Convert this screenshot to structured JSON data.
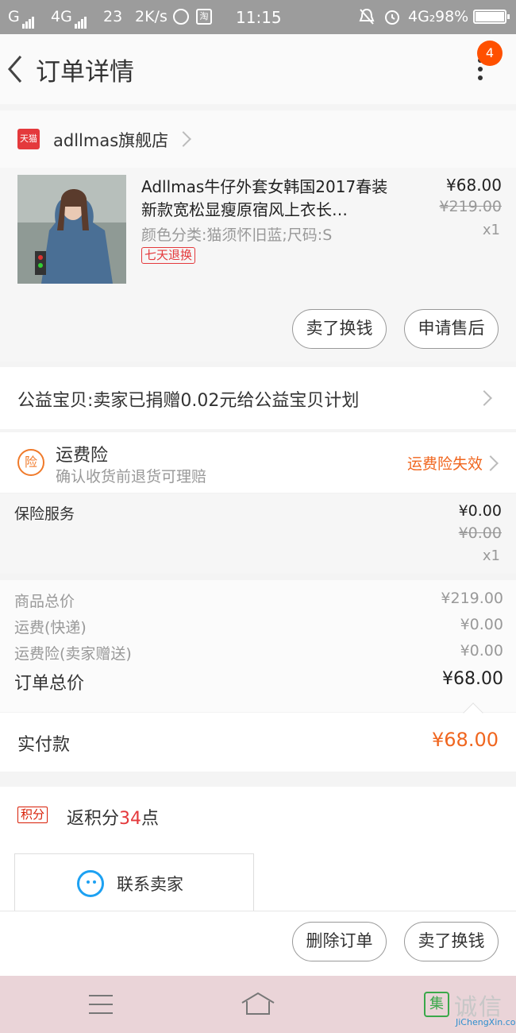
{
  "status_bar": {
    "carrier": "G",
    "network": "4G",
    "notif_count": "23",
    "speed": "2K/s",
    "time": "11:15",
    "network2": "4G₂",
    "battery": "98%"
  },
  "nav": {
    "title": "订单详情",
    "badge": "4"
  },
  "shop": {
    "tmall_tag": "天猫",
    "name": "adllmas旗舰店"
  },
  "product": {
    "title": "Adllmas牛仔外套女韩国2017春装新款宽松显瘦原宿风上衣长…",
    "sku": "颜色分类:猫须怀旧蓝;尺码:S",
    "tag": "七天退换",
    "price": "¥68.00",
    "original_price": "¥219.00",
    "quantity": "x1",
    "btn_sell": "卖了换钱",
    "btn_aftersale": "申请售后"
  },
  "charity": {
    "text": "公益宝贝:卖家已捐赠0.02元给公益宝贝计划"
  },
  "insurance": {
    "icon_text": "险",
    "title": "运费险",
    "subtitle": "确认收货前退货可理赔",
    "status": "运费险失效"
  },
  "service": {
    "label": "保险服务",
    "price": "¥0.00",
    "original": "¥0.00",
    "quantity": "x1"
  },
  "summary": {
    "rows": [
      {
        "label": "商品总价",
        "value": "¥219.00"
      },
      {
        "label": "运费(快递)",
        "value": "¥0.00"
      },
      {
        "label": "运费险(卖家赠送)",
        "value": "¥0.00"
      }
    ],
    "total_label": "订单总价",
    "total_value": "¥68.00"
  },
  "paid": {
    "label": "实付款",
    "value": "¥68.00"
  },
  "points": {
    "tag": "积分",
    "prefix": "返积分",
    "count": "34",
    "suffix": "点"
  },
  "contact": {
    "label": "联系卖家"
  },
  "actions": {
    "delete": "删除订单",
    "sell": "卖了换钱"
  },
  "watermark": {
    "logo_char": "集",
    "brand": "诚信",
    "site": "JiChengXin.com"
  },
  "colors": {
    "accent": "#f0661f",
    "tmall_red": "#e4393c",
    "badge": "#ff5000",
    "contact_blue": "#1da1f2"
  }
}
